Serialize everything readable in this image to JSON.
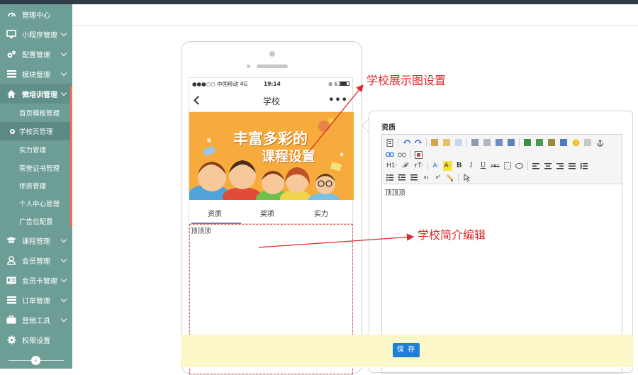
{
  "sidebar": {
    "items": [
      {
        "label": "管理中心",
        "icon": "dashboard-icon"
      },
      {
        "label": "小程序管理",
        "icon": "monitor-icon"
      },
      {
        "label": "配置管理",
        "icon": "cogs-icon"
      },
      {
        "label": "模块管理",
        "icon": "list-icon"
      },
      {
        "label": "微培训管理",
        "icon": "home-icon"
      }
    ],
    "sub_items": [
      {
        "label": "首页模板管理"
      },
      {
        "label": "学校页管理"
      },
      {
        "label": "实力管理"
      },
      {
        "label": "荣誉证书管理"
      },
      {
        "label": "师资管理"
      },
      {
        "label": "个人中心管理"
      },
      {
        "label": "广告位配置"
      }
    ],
    "lower_items": [
      {
        "label": "课程管理",
        "icon": "graduation-cap-icon"
      },
      {
        "label": "会员管理",
        "icon": "user-icon"
      },
      {
        "label": "会员卡管理",
        "icon": "id-card-icon"
      },
      {
        "label": "订单管理",
        "icon": "list-icon"
      },
      {
        "label": "营销工具",
        "icon": "briefcase-icon"
      },
      {
        "label": "权限设置",
        "icon": "gear-icon"
      }
    ],
    "collapse_glyph": "«"
  },
  "phone": {
    "carrier": "●●●○○ 中国移动  4G",
    "time": "19:14",
    "battery_text": "⊕ 61%",
    "title": "学校",
    "more": "•••",
    "banner_line1": "丰富多彩的",
    "banner_line2": "课程设置",
    "tabs": [
      "资质",
      "奖项",
      "实力"
    ],
    "content_text": "顶顶顶"
  },
  "editor": {
    "label": "资质",
    "content_text": "顶顶顶",
    "text_tools": [
      "H1·",
      "𝓕·",
      "тT·",
      "A·",
      "A·"
    ]
  },
  "footer": {
    "save_label": "保 存"
  },
  "annotations": {
    "banner_note": "学校展示图设置",
    "intro_note": "学校简介编辑"
  },
  "colors": {
    "sidebar_bg": "#6d9e96",
    "accent_red": "#e02a2a",
    "save_blue": "#1e7fd8",
    "footer_bg": "#fcf7c8"
  }
}
